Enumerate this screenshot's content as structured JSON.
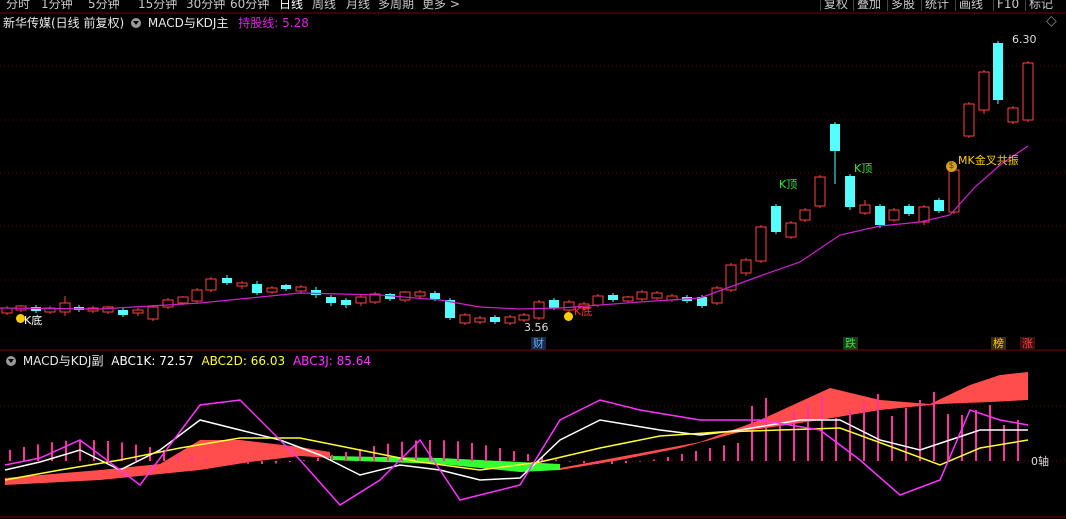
{
  "toolbar": {
    "periods": [
      "分时",
      "1分钟",
      "5分钟",
      "15分钟",
      "30分钟",
      "60分钟",
      "日线",
      "周线",
      "月线",
      "多周期",
      "更多 >"
    ],
    "active_period": "日线",
    "buttons": [
      "复权",
      "叠加",
      "多股",
      "统计",
      "画线",
      "F10",
      "标记"
    ]
  },
  "main_panel": {
    "stock_name": "新华传媒(日线 前复权)",
    "indicator_name": "MACD与KDJ主",
    "holding_line_label": "持股线: 5.28",
    "high_label": "6.30",
    "low_label": "3.56",
    "signals": {
      "k_bottom": "K底",
      "k_top_1": "K顶",
      "k_top_2": "K顶",
      "k_bottom_2": "K底",
      "mk_cross": "MK金叉共振",
      "money_icon": "$"
    },
    "bottom_markers": {
      "cai": "财",
      "die": "跌",
      "bang": "榜",
      "zhang": "涨"
    },
    "colors": {
      "up": "#ff4040",
      "down": "#54ffff",
      "holding_line": "#e020e0",
      "signal_green": "#36e836",
      "signal_yellow": "#ffcc00"
    }
  },
  "sub_panel": {
    "indicator_name": "MACD与KDJ副",
    "abc1k_label": "ABC1K: 72.57",
    "abc2d_label": "ABC2D: 66.03",
    "abc3j_label": "ABC3J: 85.64",
    "zero_axis_label": "0轴",
    "colors": {
      "k": "#ffffff",
      "d": "#ffff33",
      "j": "#ff33ff",
      "bar": "#ff3399",
      "fill_up": "#ff4d4d",
      "fill_down": "#33ff33"
    }
  }
}
